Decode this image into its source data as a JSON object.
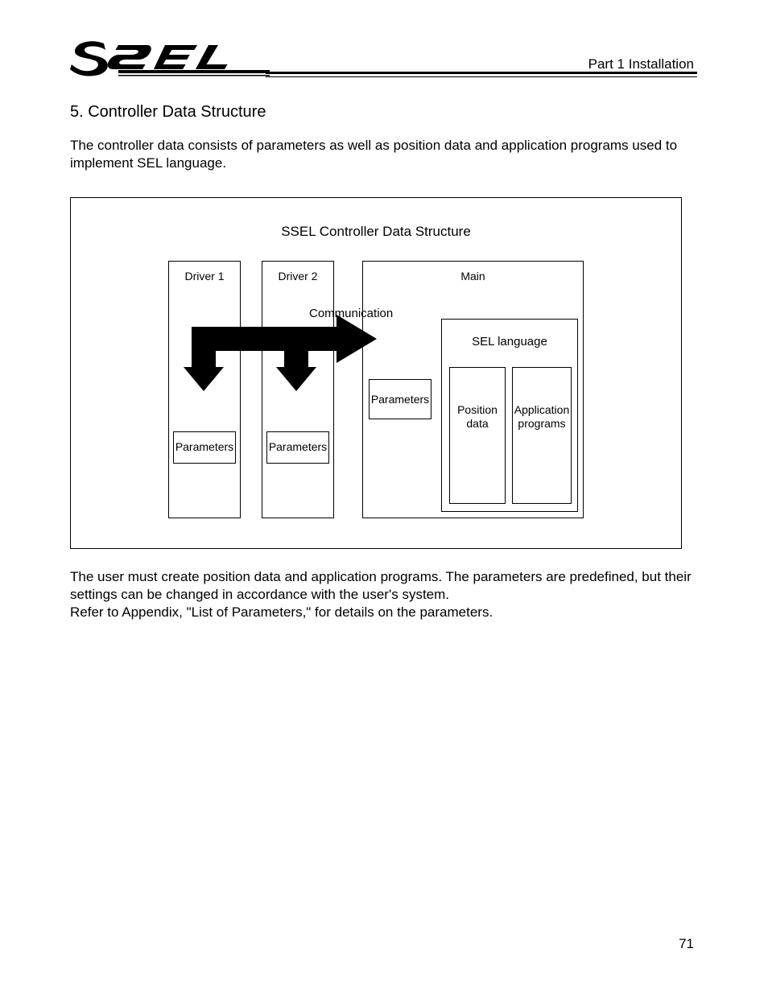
{
  "header": {
    "part": "Part 1 Installation"
  },
  "section": {
    "heading": "5.   Controller Data Structure",
    "intro": "The controller data consists of parameters as well as position data and application programs used to implement SEL language."
  },
  "figure": {
    "title": "SSEL Controller Data Structure",
    "driver1": "Driver 1",
    "driver2": "Driver 2",
    "main": "Main",
    "communication": "Communication",
    "parameters": "Parameters",
    "sel_language": "SEL language",
    "position_data": "Position data",
    "application_programs": "Application programs"
  },
  "body": {
    "para2": "The user must create position data and application programs. The parameters are predefined, but their settings can be changed in accordance with the user's system.\nRefer to Appendix, \"List of Parameters,\" for details on the parameters."
  },
  "page_number": "71"
}
